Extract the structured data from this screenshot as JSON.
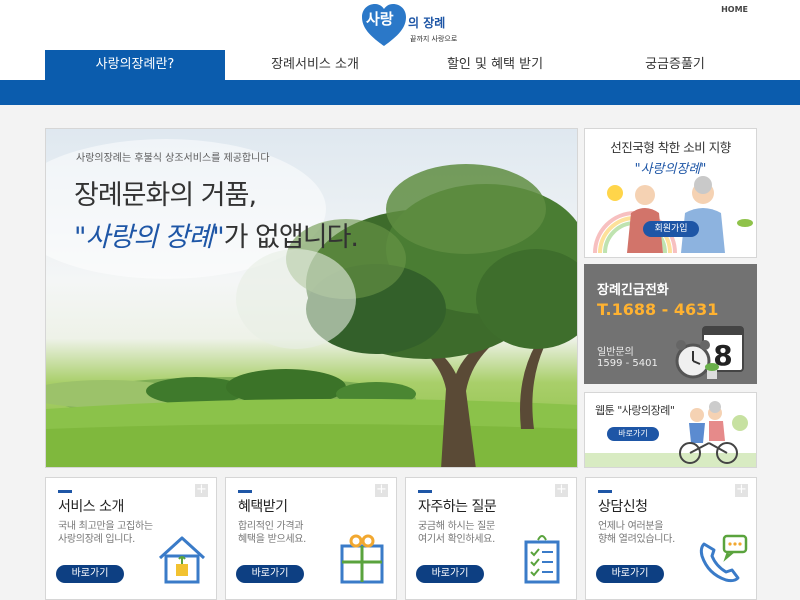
{
  "header": {
    "logo_main": "사랑",
    "logo_sub1": "의 장례",
    "logo_sub2": "끝까지 사랑으로",
    "home_link": "HOME"
  },
  "nav": {
    "items": [
      {
        "label": "사랑의장례란?",
        "active": true
      },
      {
        "label": "장례서비스 소개",
        "active": false
      },
      {
        "label": "할인 및 혜택 받기",
        "active": false
      },
      {
        "label": "궁금증풀기",
        "active": false
      }
    ]
  },
  "hero": {
    "subtitle": "사랑의장례는 후불식 상조서비스를 제공합니다",
    "title_line1": "장례문화의 거품,",
    "title_line2_highlight": "\"사랑의 장례\"",
    "title_line2_rest": "가 없앱니다."
  },
  "side": {
    "member": {
      "title": "선진국형 착한 소비 지향",
      "subtitle": "\"사랑의장례\"",
      "button": "회원가입"
    },
    "emergency": {
      "title": "장례긴급전화",
      "phone": "T.1688 - 4631",
      "general_label": "일반문의",
      "general_number": "1599 - 5401"
    },
    "webtoon": {
      "title": "웹툰 \"사랑의장례\"",
      "button": "바로가기"
    }
  },
  "cards": [
    {
      "title": "서비스 소개",
      "desc": "국내 최고만을 고집하는\n사랑의장례 입니다.",
      "button": "바로가기",
      "icon": "house-icon"
    },
    {
      "title": "혜택받기",
      "desc": "합리적인 가격과\n혜택을 받으세요.",
      "button": "바로가기",
      "icon": "gift-icon"
    },
    {
      "title": "자주하는 질문",
      "desc": "궁금해 하시는 질문\n여기서 확인하세요.",
      "button": "바로가기",
      "icon": "checklist-icon"
    },
    {
      "title": "상담신청",
      "desc": "언제나 여러분을\n향해 열려있습니다.",
      "button": "바로가기",
      "icon": "phone-chat-icon"
    }
  ],
  "colors": {
    "brand_blue": "#0b5cad",
    "dark_blue_button": "#0d3f82",
    "phone_orange": "#ffb230",
    "emergency_gray": "#727272"
  }
}
